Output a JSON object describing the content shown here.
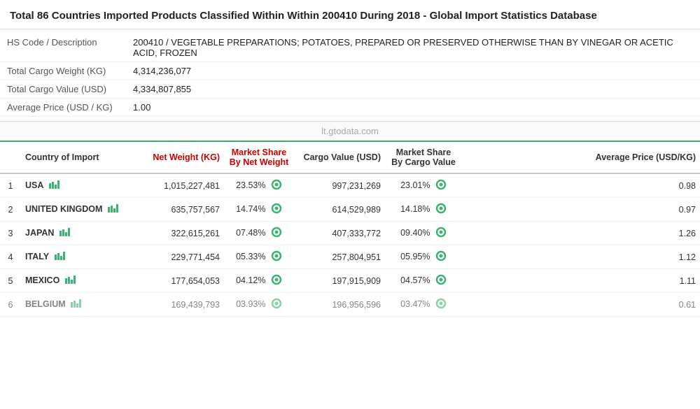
{
  "header": {
    "title_bold": "Total 86 Countries Imported Products Classified Within Within 200410 During 2018",
    "title_suffix": " - Global Import Statistics Database"
  },
  "info_rows": [
    {
      "label": "HS Code / Description",
      "value": "200410 / VEGETABLE PREPARATIONS; POTATOES, PREPARED OR PRESERVED OTHERWISE THAN BY VINEGAR OR ACETIC ACID, FROZEN"
    },
    {
      "label": "Total Cargo Weight (KG)",
      "value": "4,314,236,077"
    },
    {
      "label": "Total Cargo Value (USD)",
      "value": "4,334,807,855"
    },
    {
      "label": "Average Price (USD / KG)",
      "value": "1.00"
    }
  ],
  "watermark": "lt.gtodata.com",
  "columns": [
    {
      "key": "num",
      "label": "",
      "class": ""
    },
    {
      "key": "country",
      "label": "Country of Import",
      "class": ""
    },
    {
      "key": "net_weight",
      "label": "Net Weight (KG)",
      "class": "red-header"
    },
    {
      "key": "market_share_nw",
      "label": "Market Share By Net Weight",
      "class": "red-header"
    },
    {
      "key": "cargo_value",
      "label": "Cargo Value (USD)",
      "class": ""
    },
    {
      "key": "market_share_cv",
      "label": "Market Share By Cargo Value",
      "class": ""
    },
    {
      "key": "avg_price",
      "label": "Average Price (USD/KG)",
      "class": ""
    }
  ],
  "rows": [
    {
      "num": "1",
      "country": "USA",
      "net_weight": "1,015,227,481",
      "market_share_nw": "23.53%",
      "cargo_value": "997,231,269",
      "market_share_cv": "23.01%",
      "avg_price": "0.98"
    },
    {
      "num": "2",
      "country": "UNITED KINGDOM",
      "net_weight": "635,757,567",
      "market_share_nw": "14.74%",
      "cargo_value": "614,529,989",
      "market_share_cv": "14.18%",
      "avg_price": "0.97"
    },
    {
      "num": "3",
      "country": "JAPAN",
      "net_weight": "322,615,261",
      "market_share_nw": "07.48%",
      "cargo_value": "407,333,772",
      "market_share_cv": "09.40%",
      "avg_price": "1.26"
    },
    {
      "num": "4",
      "country": "ITALY",
      "net_weight": "229,771,454",
      "market_share_nw": "05.33%",
      "cargo_value": "257,804,951",
      "market_share_cv": "05.95%",
      "avg_price": "1.12"
    },
    {
      "num": "5",
      "country": "MEXICO",
      "net_weight": "177,654,053",
      "market_share_nw": "04.12%",
      "cargo_value": "197,915,909",
      "market_share_cv": "04.57%",
      "avg_price": "1.11"
    },
    {
      "num": "6",
      "country": "BELGIUM",
      "net_weight": "169,439,793",
      "market_share_nw": "03.93%",
      "cargo_value": "196,956,596",
      "market_share_cv": "03.47%",
      "avg_price": "0.61"
    }
  ]
}
